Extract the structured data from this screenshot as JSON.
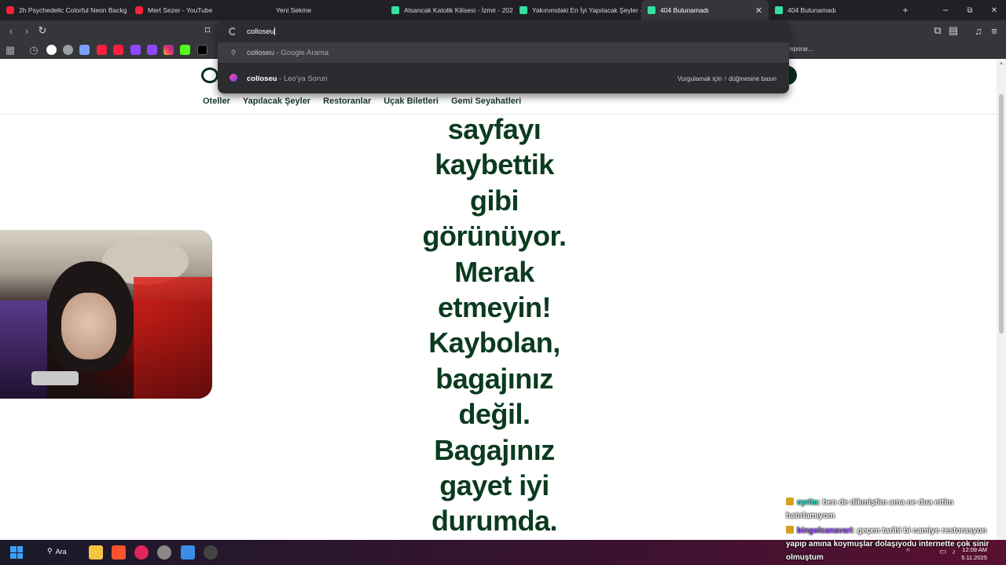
{
  "tabs": [
    {
      "title": "2h Psychedelic Colorful Neon Backg",
      "favicon": "youtube-icon",
      "active": false
    },
    {
      "title": "Mert Sezer - YouTube",
      "favicon": "youtube-icon",
      "active": false
    },
    {
      "title": "Yeni Sekme",
      "favicon": "none",
      "active": false
    },
    {
      "title": "Alsancak Katolik Kilisesi - İzmir - 202",
      "favicon": "tripadvisor-icon",
      "active": false
    },
    {
      "title": "Yakınımdaki En İyi Yapılacak Şeyler -",
      "favicon": "tripadvisor-icon",
      "active": false
    },
    {
      "title": "404 Bulunamadı",
      "favicon": "tripadvisor-icon",
      "active": true
    },
    {
      "title": "404 Bulunamadı",
      "favicon": "tripadvisor-icon",
      "active": false
    }
  ],
  "window_controls": {
    "new_tab": "+",
    "minimize": "−",
    "maximize": "⧉",
    "close": "✕"
  },
  "omnibox": {
    "typed": "colloseu",
    "suggestions": [
      {
        "bold": "colloseu",
        "rest": " - Google Arama",
        "icon": "search-icon"
      },
      {
        "bold": "colloseu",
        "rest": " - Leo'ya Sorun",
        "icon": "leo-icon",
        "hint": "Vurgulamak için ↑ düğmesine basın"
      }
    ]
  },
  "bookmarks": {
    "overflow_text": "mporar..."
  },
  "page": {
    "nav": [
      "Oteller",
      "Yapılacak Şeyler",
      "Restoranlar",
      "Uçak Biletleri",
      "Gemi Seyahatleri"
    ],
    "headline_lines": [
      "sayfayı",
      "kaybettik",
      "gibi",
      "görünüyor.",
      "Merak",
      "etmeyin!",
      "Kaybolan,",
      "bagajınız",
      "değil.",
      "Bagajınız",
      "gayet iyi",
      "durumda."
    ]
  },
  "chat": {
    "messages": [
      {
        "user": "cyrita",
        "text": ": ben de dikmiştim ama ne dua ettim hatırlamıyom"
      },
      {
        "user": "bingolcanavari",
        "text": ": geçen tarihi bi camiye restorasyon yapıp amına koymuşlar dolaşıyodu internette çok sinir olmuştum"
      }
    ]
  },
  "taskbar": {
    "search_label": "Ara",
    "time": "12:09 AM",
    "date": "5.11.2025"
  },
  "colors": {
    "tab_bg": "#202124",
    "toolbar_bg": "#35363a",
    "headline_green": "#0b3a1f",
    "chat_user1": "#2ce8d0",
    "chat_user2": "#a55cff"
  }
}
